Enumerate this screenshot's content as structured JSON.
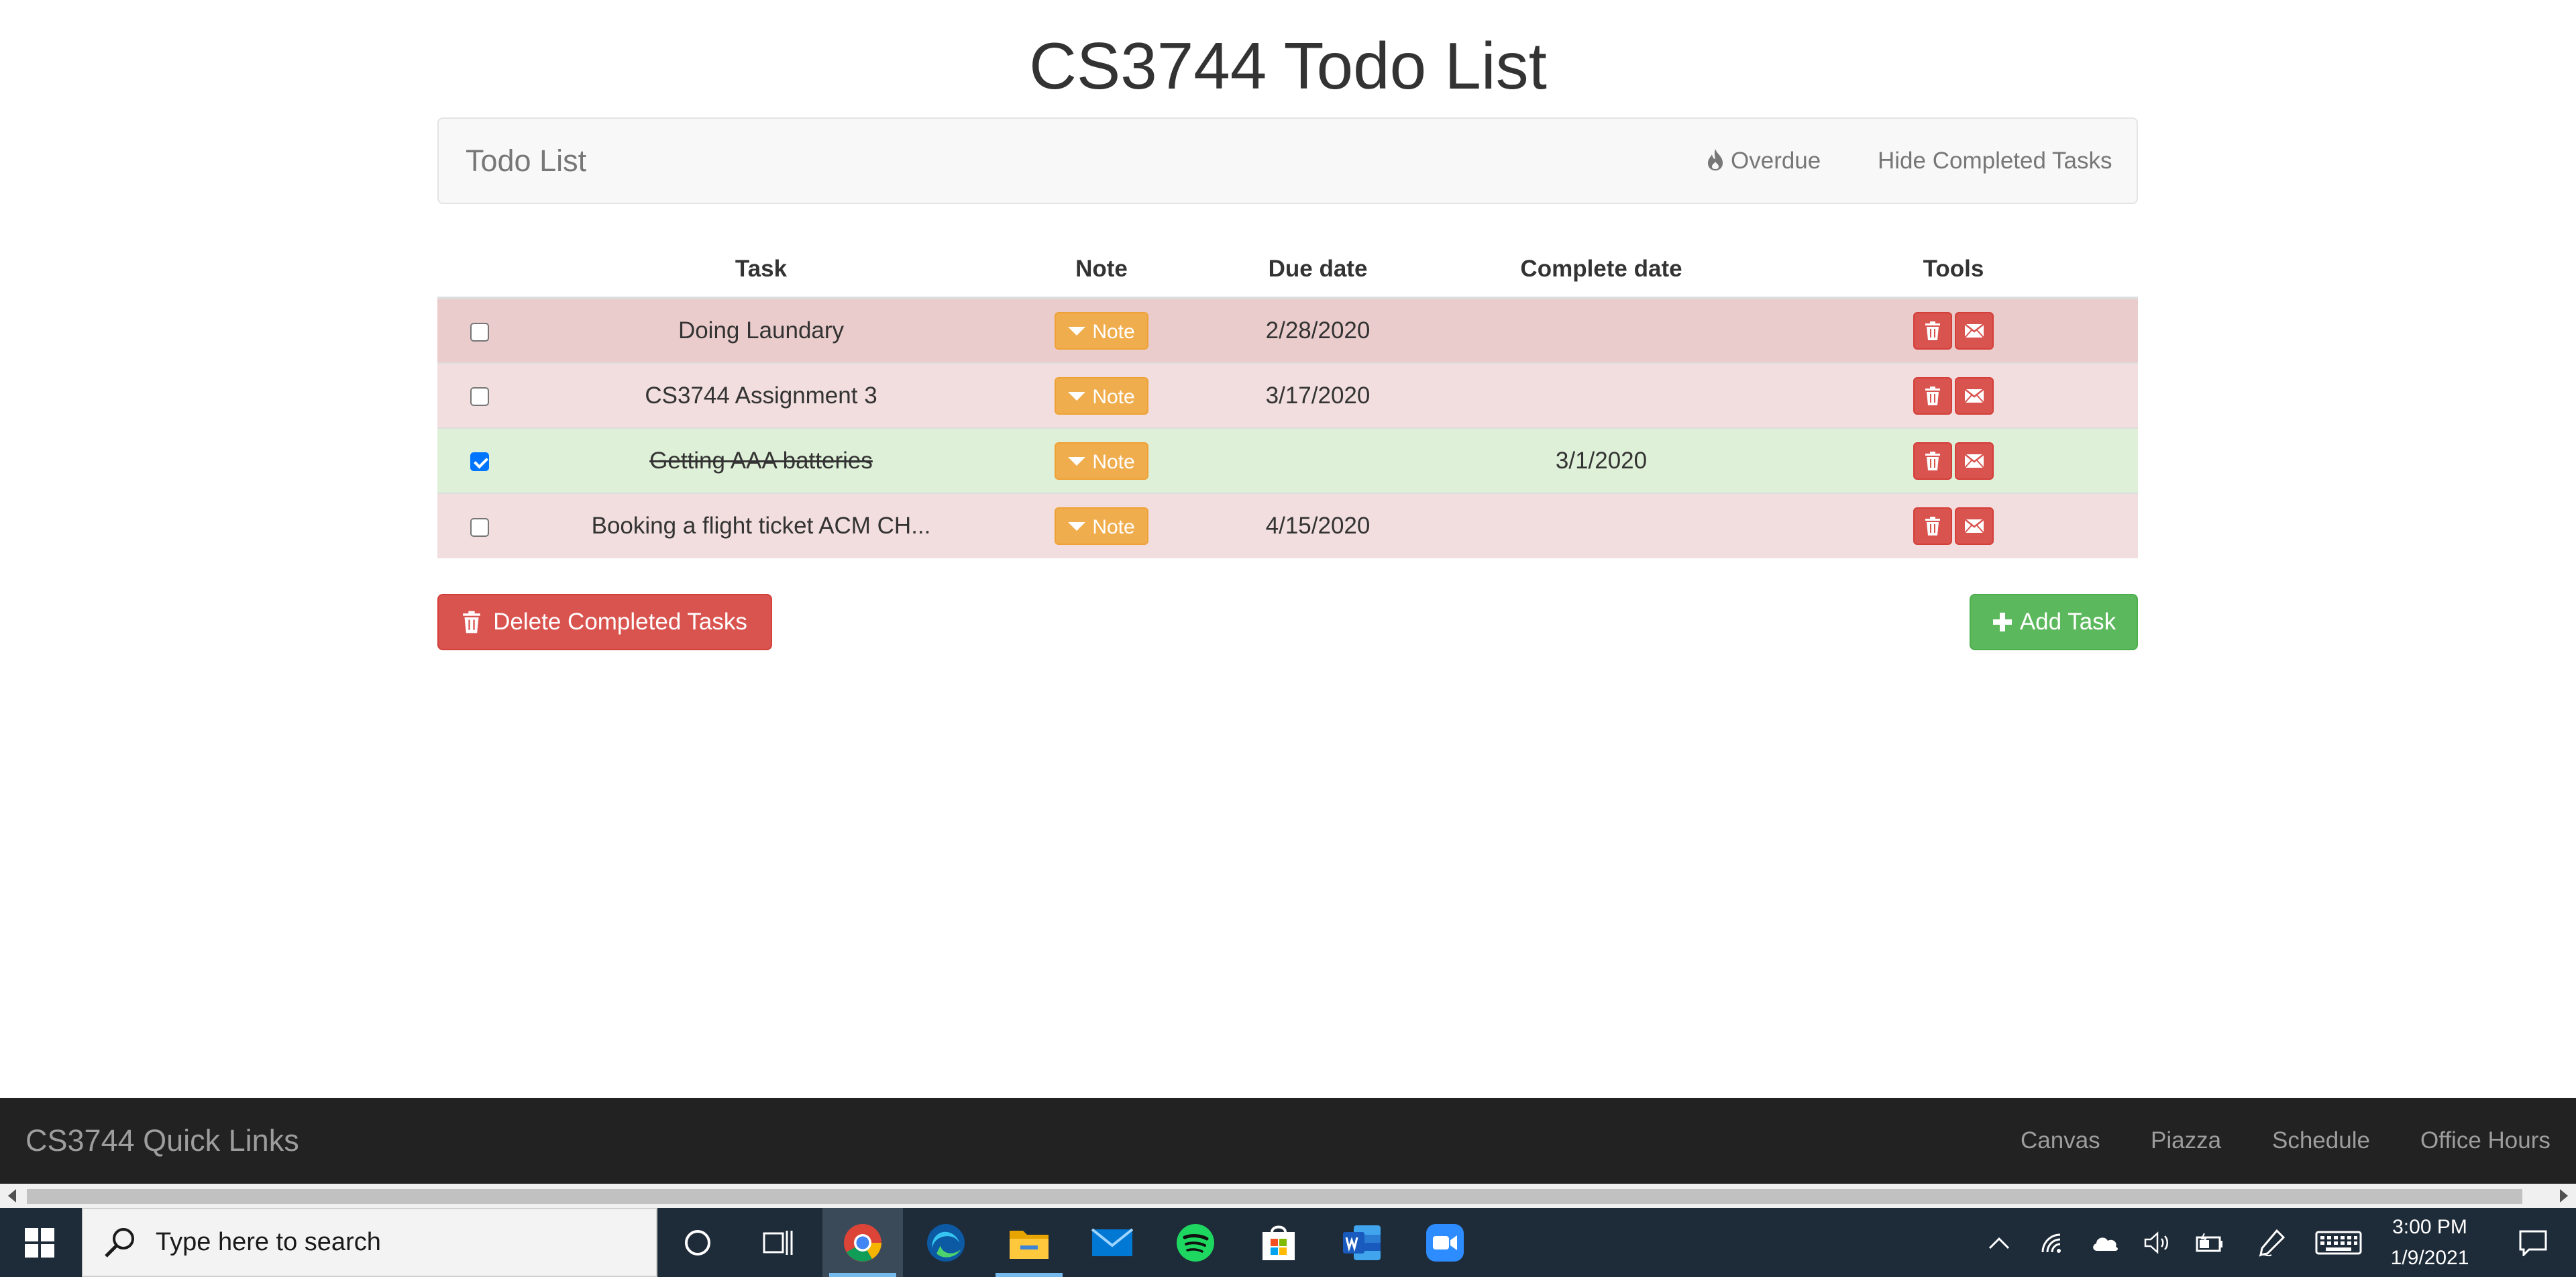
{
  "page": {
    "title": "CS3744 Todo List"
  },
  "navbar": {
    "brand": "Todo List",
    "overdue_label": "Overdue",
    "hide_completed_label": "Hide Completed Tasks"
  },
  "table": {
    "headers": {
      "task": "Task",
      "note": "Note",
      "due": "Due date",
      "complete": "Complete date",
      "tools": "Tools"
    },
    "rows": [
      {
        "checked": false,
        "task": "Doing Laundary",
        "note": "Note",
        "due": "2/28/2020",
        "complete": "",
        "status": "overdue"
      },
      {
        "checked": false,
        "task": "CS3744 Assignment 3",
        "note": "Note",
        "due": "3/17/2020",
        "complete": "",
        "status": "overdue"
      },
      {
        "checked": true,
        "task": "Getting AAA batteries",
        "note": "Note",
        "due": "",
        "complete": "3/1/2020",
        "status": "completed"
      },
      {
        "checked": false,
        "task": "Booking a flight ticket ACM CH...",
        "note": "Note",
        "due": "4/15/2020",
        "complete": "",
        "status": "overdue"
      }
    ]
  },
  "actions": {
    "delete_completed_label": "Delete Completed Tasks",
    "add_task_label": "Add Task"
  },
  "footer": {
    "brand": "CS3744 Quick Links",
    "links": [
      "Canvas",
      "Piazza",
      "Schedule",
      "Office Hours"
    ]
  },
  "taskbar": {
    "search_placeholder": "Type here to search",
    "time": "3:00 PM",
    "date": "1/9/2021",
    "pinned_apps": [
      "cortana-icon",
      "task-view-icon",
      "chrome-icon",
      "edge-icon",
      "file-explorer-icon",
      "mail-icon",
      "spotify-icon",
      "store-icon",
      "word-icon",
      "zoom-icon"
    ]
  },
  "colors": {
    "overdue_row": "#f2dede",
    "completed_row": "#dff0d8",
    "danger": "#d9534f",
    "warning": "#f0ad4e",
    "success": "#5cb85c",
    "footer_bg": "#222222",
    "taskbar_bg": "#1e2b38"
  }
}
